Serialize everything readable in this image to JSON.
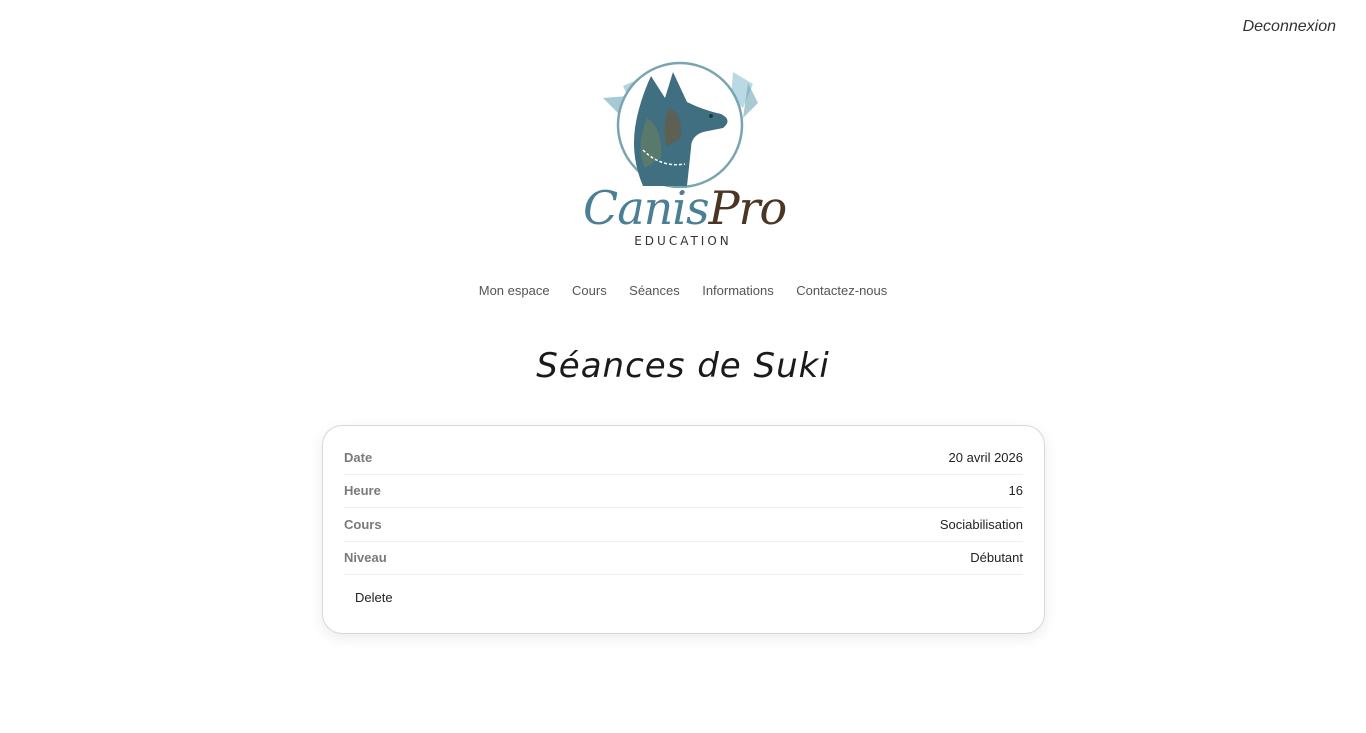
{
  "header": {
    "logout_label": "Deconnexion"
  },
  "brand": {
    "name_part1": "Canis",
    "name_part2": "Pro",
    "subtitle": "EDUCATION",
    "colors": {
      "primary_blue": "#4a7f95",
      "brown": "#4b3524",
      "light_blue": "#a8d1dd"
    }
  },
  "nav": {
    "items": [
      {
        "label": "Mon espace"
      },
      {
        "label": "Cours"
      },
      {
        "label": "Séances"
      },
      {
        "label": "Informations"
      },
      {
        "label": "Contactez-nous"
      }
    ]
  },
  "page": {
    "title": "Séances de Suki"
  },
  "session": {
    "rows": [
      {
        "label": "Date",
        "value": "20 avril 2026"
      },
      {
        "label": "Heure",
        "value": "16"
      },
      {
        "label": "Cours",
        "value": "Sociabilisation"
      },
      {
        "label": "Niveau",
        "value": "Débutant"
      }
    ],
    "delete_label": "Delete"
  }
}
